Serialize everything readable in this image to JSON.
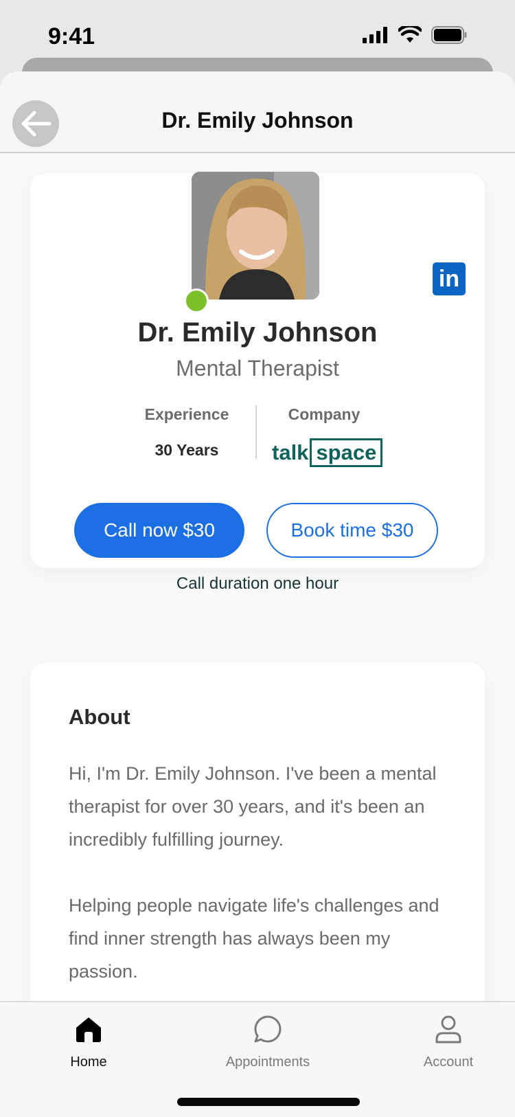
{
  "status_bar": {
    "time": "9:41",
    "icons": [
      "signal-icon",
      "wifi-icon",
      "battery-icon"
    ]
  },
  "nav": {
    "title": "Dr. Emily Johnson",
    "back_icon": "back-arrow-icon"
  },
  "profile": {
    "name": "Dr. Emily Johnson",
    "title": "Mental Therapist",
    "online": true,
    "status_color": "#7cc02a",
    "experience_label": "Experience",
    "experience_value": "30 Years",
    "company_label": "Company",
    "company_logo_left": "talk",
    "company_logo_right": "space",
    "social_icon": "linkedin-icon",
    "linkedin_letters": "in"
  },
  "actions": {
    "call_label": "Call now $30",
    "book_label": "Book time $30",
    "call_duration": "Call duration one hour",
    "accent": "#1c6fe3"
  },
  "about": {
    "title": "About",
    "paragraphs": [
      "Hi, I'm Dr. Emily Johnson. I've been a mental therapist for over 30 years, and it's been an incredibly fulfilling journey.",
      "Helping people navigate life's challenges and find inner strength has always been my passion."
    ]
  },
  "tabs": [
    {
      "label": "Home",
      "icon": "home-icon",
      "active": true
    },
    {
      "label": "Appointments",
      "icon": "chat-bubble-icon",
      "active": false
    },
    {
      "label": "Account",
      "icon": "user-icon",
      "active": false
    }
  ]
}
